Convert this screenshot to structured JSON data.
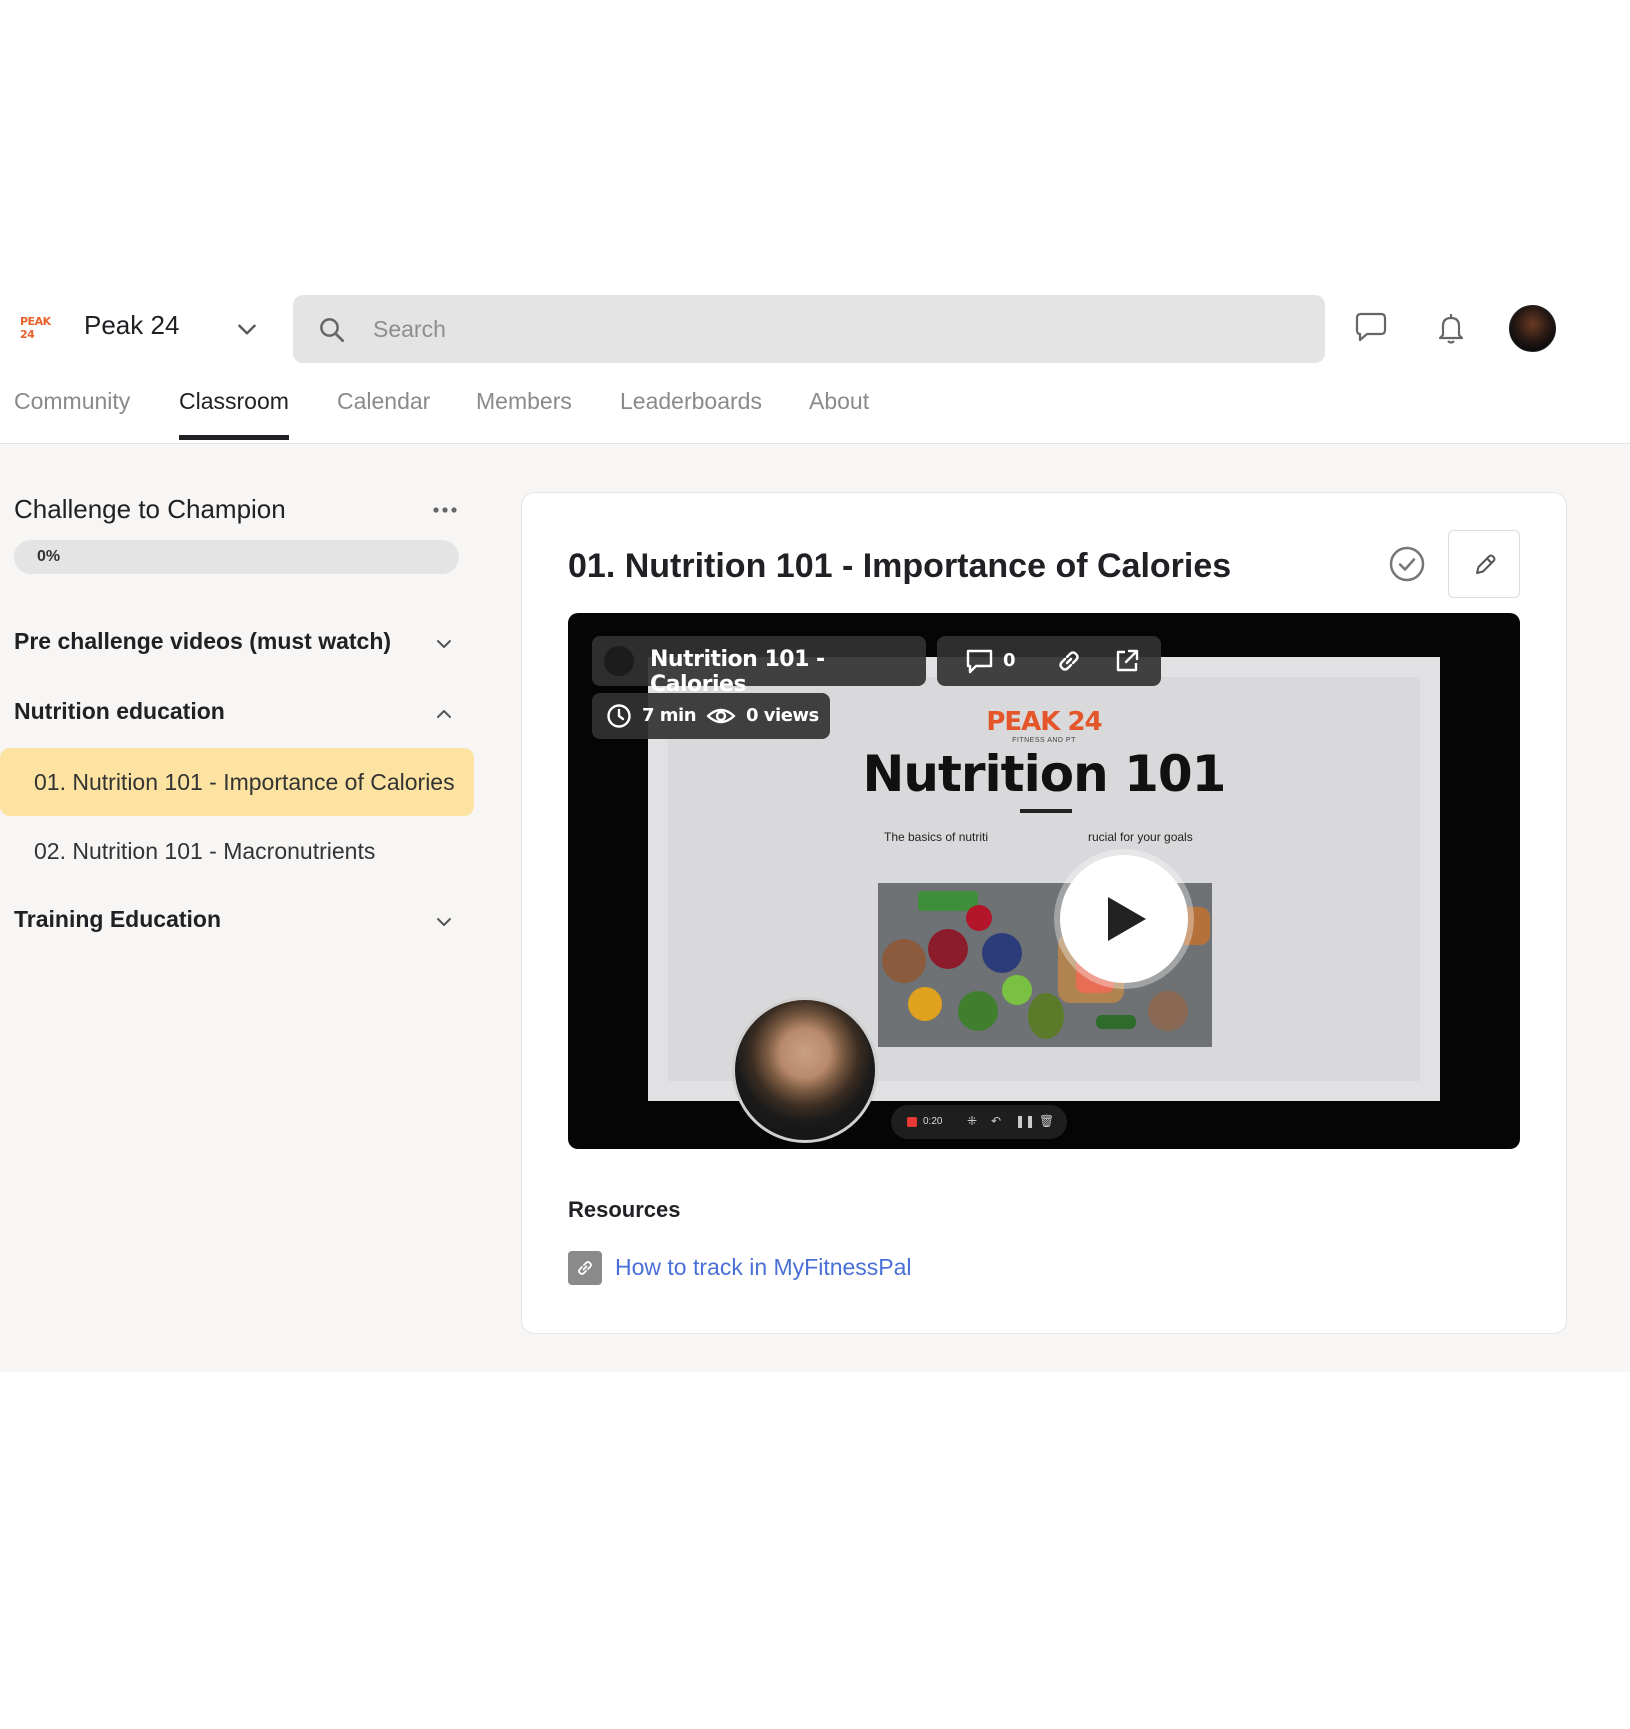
{
  "header": {
    "brand_logo_text": "PEAK 24",
    "community_name": "Peak 24",
    "search_placeholder": "Search"
  },
  "tabs": [
    {
      "label": "Community",
      "active": false
    },
    {
      "label": "Classroom",
      "active": true
    },
    {
      "label": "Calendar",
      "active": false
    },
    {
      "label": "Members",
      "active": false
    },
    {
      "label": "Leaderboards",
      "active": false
    },
    {
      "label": "About",
      "active": false
    }
  ],
  "sidebar": {
    "course_title": "Challenge to Champion",
    "progress_label": "0%",
    "progress_fraction": 0,
    "sections": [
      {
        "title": "Pre challenge videos (must watch)",
        "expanded": false
      },
      {
        "title": "Nutrition education",
        "expanded": true,
        "lessons": [
          {
            "title": "01. Nutrition 101 - Importance of Calories",
            "active": true
          },
          {
            "title": "02. Nutrition 101 - Macronutrients",
            "active": false
          }
        ]
      },
      {
        "title": "Training Education",
        "expanded": false
      }
    ]
  },
  "lesson": {
    "title": "01. Nutrition 101 - Importance of Calories",
    "video": {
      "overlay_title": "Nutrition 101 - Calories",
      "comment_count": "0",
      "duration": "7 min",
      "views": "0 views",
      "slide_brand": "PEAK 24",
      "slide_brand_sub": "FITNESS AND PT",
      "slide_title": "Nutrition 101",
      "slide_subtitle_left": "The basics of nutriti",
      "slide_subtitle_right": "rucial for your goals",
      "recording_time": "0:20"
    },
    "resources_heading": "Resources",
    "resources": [
      {
        "label": "How to track in MyFitnessPal"
      }
    ]
  },
  "colors": {
    "accent_active_lesson": "#fce3a1",
    "link": "#4a6fd6",
    "brand_orange": "#e4562a"
  }
}
